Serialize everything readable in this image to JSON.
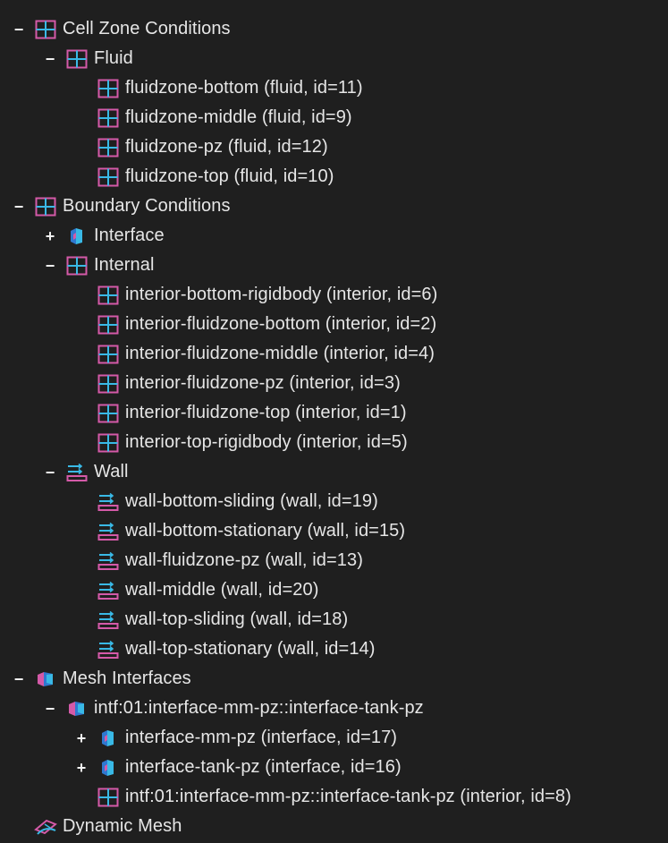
{
  "colors": {
    "background": "#1f1f1f",
    "text": "#e6e6e6",
    "icon_pink": "#d45aa8",
    "icon_cyan": "#39b9e6",
    "icon_blue": "#2f78d0"
  },
  "tree": [
    {
      "level": 0,
      "toggle": "−",
      "icon": "cell-zone-icon",
      "label": "Cell Zone Conditions"
    },
    {
      "level": 1,
      "toggle": "−",
      "icon": "cell-zone-icon",
      "label": "Fluid"
    },
    {
      "level": 2,
      "toggle": "",
      "icon": "cell-zone-icon",
      "label": "fluidzone-bottom (fluid, id=11)"
    },
    {
      "level": 2,
      "toggle": "",
      "icon": "cell-zone-icon",
      "label": "fluidzone-middle (fluid, id=9)"
    },
    {
      "level": 2,
      "toggle": "",
      "icon": "cell-zone-icon",
      "label": "fluidzone-pz (fluid, id=12)"
    },
    {
      "level": 2,
      "toggle": "",
      "icon": "cell-zone-icon",
      "label": "fluidzone-top (fluid, id=10)"
    },
    {
      "level": 0,
      "toggle": "−",
      "icon": "cell-zone-icon",
      "label": "Boundary Conditions"
    },
    {
      "level": 1,
      "toggle": "+",
      "icon": "interface-icon",
      "label": "Interface"
    },
    {
      "level": 1,
      "toggle": "−",
      "icon": "cell-zone-icon",
      "label": "Internal"
    },
    {
      "level": 2,
      "toggle": "",
      "icon": "cell-zone-icon",
      "label": "interior-bottom-rigidbody (interior, id=6)"
    },
    {
      "level": 2,
      "toggle": "",
      "icon": "cell-zone-icon",
      "label": "interior-fluidzone-bottom (interior, id=2)"
    },
    {
      "level": 2,
      "toggle": "",
      "icon": "cell-zone-icon",
      "label": "interior-fluidzone-middle (interior, id=4)"
    },
    {
      "level": 2,
      "toggle": "",
      "icon": "cell-zone-icon",
      "label": "interior-fluidzone-pz (interior, id=3)"
    },
    {
      "level": 2,
      "toggle": "",
      "icon": "cell-zone-icon",
      "label": "interior-fluidzone-top (interior, id=1)"
    },
    {
      "level": 2,
      "toggle": "",
      "icon": "cell-zone-icon",
      "label": "interior-top-rigidbody (interior, id=5)"
    },
    {
      "level": 1,
      "toggle": "−",
      "icon": "wall-icon",
      "label": "Wall"
    },
    {
      "level": 2,
      "toggle": "",
      "icon": "wall-icon",
      "label": "wall-bottom-sliding (wall, id=19)"
    },
    {
      "level": 2,
      "toggle": "",
      "icon": "wall-icon",
      "label": "wall-bottom-stationary (wall, id=15)"
    },
    {
      "level": 2,
      "toggle": "",
      "icon": "wall-icon",
      "label": "wall-fluidzone-pz (wall, id=13)"
    },
    {
      "level": 2,
      "toggle": "",
      "icon": "wall-icon",
      "label": "wall-middle (wall, id=20)"
    },
    {
      "level": 2,
      "toggle": "",
      "icon": "wall-icon",
      "label": "wall-top-sliding (wall, id=18)"
    },
    {
      "level": 2,
      "toggle": "",
      "icon": "wall-icon",
      "label": "wall-top-stationary (wall, id=14)"
    },
    {
      "level": 0,
      "toggle": "−",
      "icon": "mesh-interface-icon",
      "label": "Mesh Interfaces"
    },
    {
      "level": 1,
      "toggle": "−",
      "icon": "mesh-interface-icon",
      "label": "intf:01:interface-mm-pz::interface-tank-pz"
    },
    {
      "level": 2,
      "toggle": "+",
      "icon": "interface-icon",
      "label": "interface-mm-pz (interface, id=17)"
    },
    {
      "level": 2,
      "toggle": "+",
      "icon": "interface-icon",
      "label": "interface-tank-pz (interface, id=16)"
    },
    {
      "level": 2,
      "toggle": "",
      "icon": "cell-zone-icon",
      "label": "intf:01:interface-mm-pz::interface-tank-pz (interior, id=8)"
    },
    {
      "level": 0,
      "toggle": "",
      "icon": "dynamic-mesh-icon",
      "label": "Dynamic Mesh"
    }
  ]
}
